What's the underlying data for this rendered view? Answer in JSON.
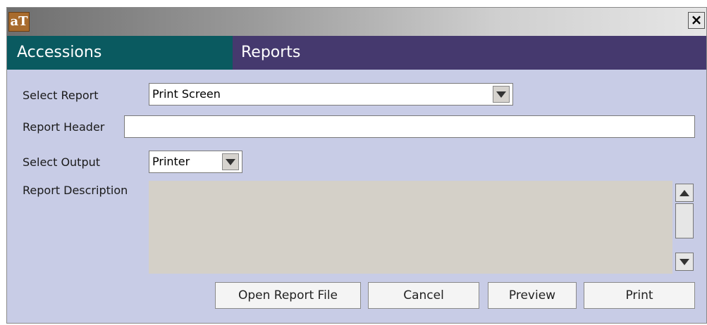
{
  "window": {
    "app_icon_text": "aT",
    "close_label": "×"
  },
  "tabs": {
    "accessions": "Accessions",
    "reports": "Reports"
  },
  "form": {
    "select_report_label": "Select Report",
    "select_report_value": "Print Screen",
    "report_header_label": "Report Header",
    "report_header_value": "",
    "select_output_label": "Select Output",
    "select_output_value": "Printer",
    "report_description_label": "Report Description",
    "report_description_value": ""
  },
  "buttons": {
    "open_report_file": "Open Report File",
    "cancel": "Cancel",
    "preview": "Preview",
    "print": "Print"
  },
  "colors": {
    "tab_accessions_bg": "#0a5a60",
    "tab_reports_bg": "#45396e",
    "panel_bg": "#c8cce6"
  }
}
